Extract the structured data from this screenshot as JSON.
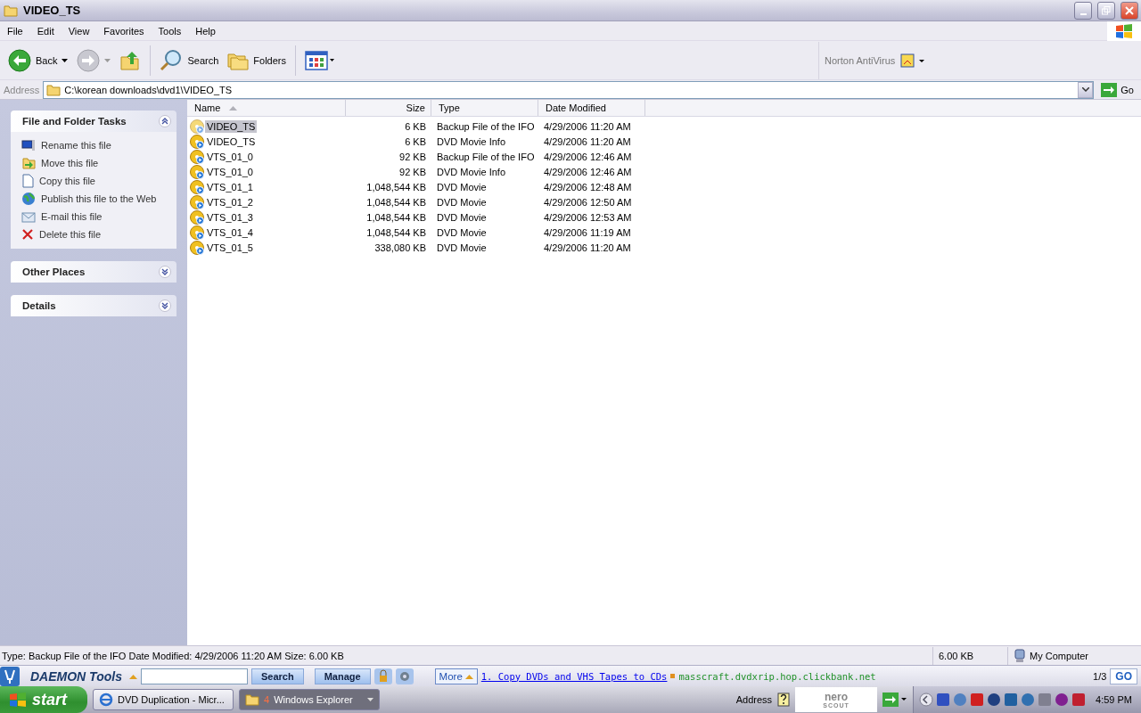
{
  "window": {
    "title": "VIDEO_TS"
  },
  "menu": [
    "File",
    "Edit",
    "View",
    "Favorites",
    "Tools",
    "Help"
  ],
  "toolbar": {
    "buttons": [
      {
        "kind": "back",
        "label": "Back"
      },
      {
        "kind": "forward"
      },
      {
        "kind": "up"
      },
      {
        "kind": "search",
        "label": "Search"
      },
      {
        "kind": "folders",
        "label": "Folders"
      },
      {
        "kind": "views"
      }
    ],
    "norton": "Norton AntiVirus"
  },
  "address": {
    "label": "Address",
    "value": "C:\\korean downloads\\dvd1\\VIDEO_TS",
    "go": "Go"
  },
  "task_panes": [
    {
      "title": "File and Folder Tasks",
      "expanded": true,
      "items": [
        {
          "kind": "rename",
          "label": "Rename this file"
        },
        {
          "kind": "move",
          "label": "Move this file"
        },
        {
          "kind": "copy",
          "label": "Copy this file"
        },
        {
          "kind": "publish",
          "label": "Publish this file to the Web"
        },
        {
          "kind": "email",
          "label": "E-mail this file"
        },
        {
          "kind": "delete",
          "label": "Delete this file"
        }
      ]
    },
    {
      "title": "Other Places",
      "expanded": false
    },
    {
      "title": "Details",
      "expanded": false
    }
  ],
  "table": {
    "columns": [
      {
        "label": "Name",
        "sorted": true
      },
      {
        "label": "Size",
        "sorted": false
      },
      {
        "label": "Type",
        "sorted": false
      },
      {
        "label": "Date Modified",
        "sorted": false
      }
    ],
    "rows": [
      {
        "name": "VIDEO_TS",
        "size": "6 KB",
        "type": "Backup File of the IFO",
        "date": "4/29/2006 11:20 AM",
        "selected": true
      },
      {
        "name": "VIDEO_TS",
        "size": "6 KB",
        "type": "DVD Movie Info",
        "date": "4/29/2006 11:20 AM",
        "selected": false
      },
      {
        "name": "VTS_01_0",
        "size": "92 KB",
        "type": "Backup File of the IFO",
        "date": "4/29/2006 12:46 AM",
        "selected": false
      },
      {
        "name": "VTS_01_0",
        "size": "92 KB",
        "type": "DVD Movie Info",
        "date": "4/29/2006 12:46 AM",
        "selected": false
      },
      {
        "name": "VTS_01_1",
        "size": "1,048,544 KB",
        "type": "DVD Movie",
        "date": "4/29/2006 12:48 AM",
        "selected": false
      },
      {
        "name": "VTS_01_2",
        "size": "1,048,544 KB",
        "type": "DVD Movie",
        "date": "4/29/2006 12:50 AM",
        "selected": false
      },
      {
        "name": "VTS_01_3",
        "size": "1,048,544 KB",
        "type": "DVD Movie",
        "date": "4/29/2006 12:53 AM",
        "selected": false
      },
      {
        "name": "VTS_01_4",
        "size": "1,048,544 KB",
        "type": "DVD Movie",
        "date": "4/29/2006 11:19 AM",
        "selected": false
      },
      {
        "name": "VTS_01_5",
        "size": "338,080 KB",
        "type": "DVD Movie",
        "date": "4/29/2006 11:20 AM",
        "selected": false
      }
    ]
  },
  "status_bar": {
    "text": "Type: Backup File of the IFO Date Modified: 4/29/2006 11:20 AM Size: 6.00 KB",
    "size": "6.00 KB",
    "zone": "My Computer"
  },
  "daemon_bar": {
    "title": "DAEMON Tools",
    "search": "Search",
    "manage": "Manage",
    "more": "More",
    "link": "1. Copy DVDs and VHS Tapes to CDs",
    "url": "masscraft.dvdxrip.hop.clickbank.net",
    "page": "1/3",
    "go": "GO"
  },
  "taskbar": {
    "start": "start",
    "tasks": [
      {
        "kind": "browser",
        "label": "DVD Duplication - Micr...",
        "selected": false
      },
      {
        "kind": "folder",
        "count": "4",
        "label": "Windows Explorer",
        "selected": true
      }
    ],
    "address": "Address",
    "nero": "nero",
    "scout": "SCOUT",
    "clock": "4:59 PM"
  }
}
